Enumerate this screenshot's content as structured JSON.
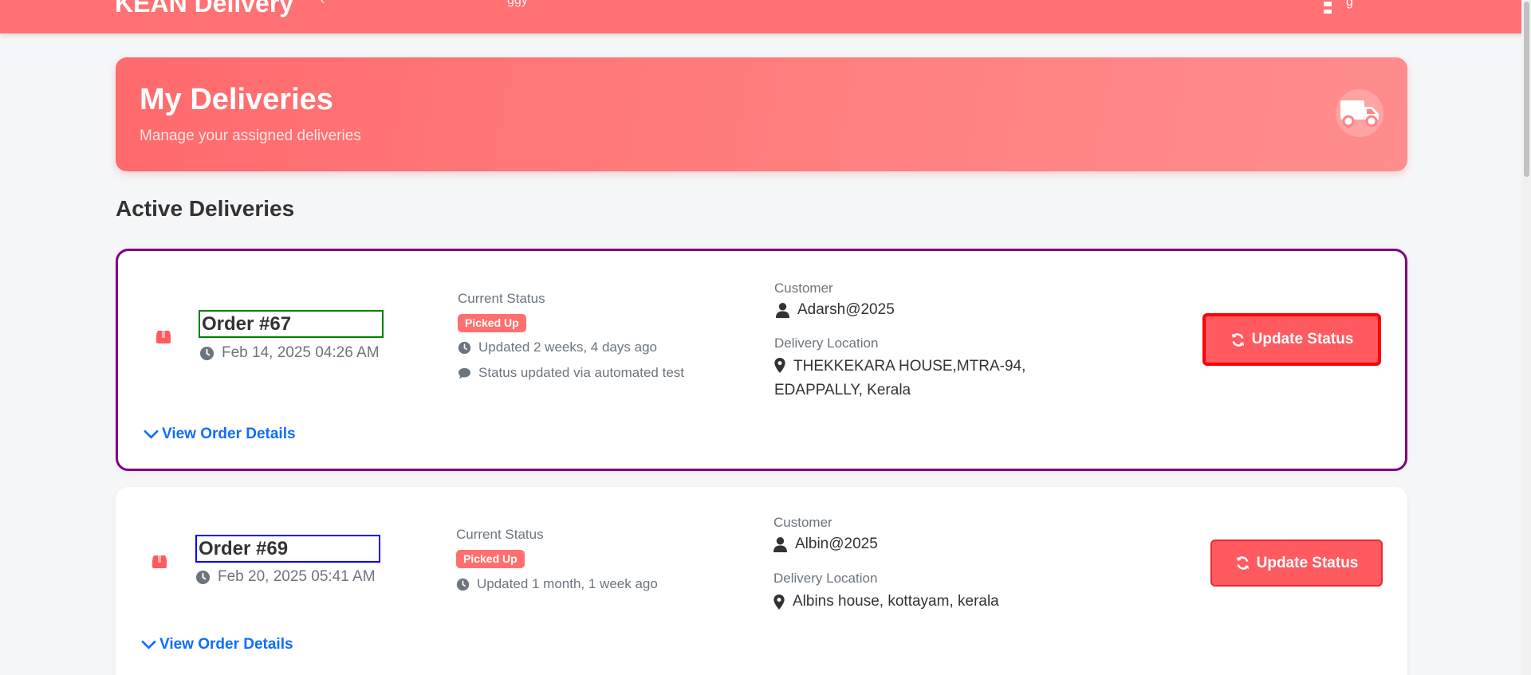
{
  "app": {
    "brand": "KEAN Delivery"
  },
  "header": {
    "nav_frag_1": "‹",
    "nav_frag_2": "ggy",
    "user_frag": "g"
  },
  "hero": {
    "title": "My Deliveries",
    "subtitle": "Manage your assigned deliveries",
    "icon": "truck-icon"
  },
  "section_title": "Active Deliveries",
  "orders": [
    {
      "title": "Order #67",
      "date": "Feb 14, 2025 04:26 AM",
      "status_label": "Current Status",
      "status": "Picked Up",
      "updated": "Updated 2 weeks, 4 days ago",
      "note": "Status updated via automated test",
      "customer_label": "Customer",
      "customer": "Adarsh@2025",
      "location_label": "Delivery Location",
      "location": "THEKKEKARA HOUSE,MTRA-94, EDAPPALLY, Kerala",
      "button": "Update Status",
      "details_link": "View Order Details"
    },
    {
      "title": "Order #69",
      "date": "Feb 20, 2025 05:41 AM",
      "status_label": "Current Status",
      "status": "Picked Up",
      "updated": "Updated 1 month, 1 week ago",
      "customer_label": "Customer",
      "customer": "Albin@2025",
      "location_label": "Delivery Location",
      "location": "Albins house, kottayam, kerala",
      "button": "Update Status",
      "details_link": "View Order Details"
    }
  ],
  "colors": {
    "accent": "#ff6b6b",
    "card1_border": "#800080",
    "order1_outline": "#008000",
    "order2_outline": "#0000ff",
    "button1_border": "#ff0000",
    "link": "#0d6efd"
  }
}
